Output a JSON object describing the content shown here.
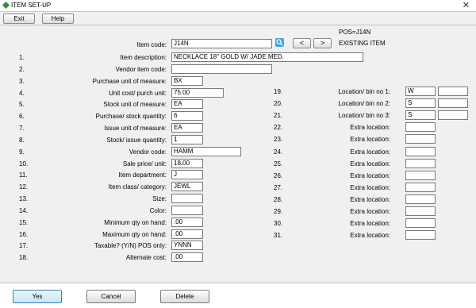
{
  "window": {
    "title": "ITEM SET-UP",
    "close_glyph": "✕"
  },
  "toolbar": {
    "exit_label": "Exit",
    "help_label": "Help"
  },
  "header": {
    "pos_label": "POS=J14N",
    "status": "EXISTING ITEM",
    "prev_label": "<",
    "next_label": ">"
  },
  "item_code": {
    "label": "Item code:",
    "value": "J14N"
  },
  "fields": [
    {
      "num": "1.",
      "label": "Item description:",
      "value": "NECKLACE 18\" GOLD W/ JADE MED."
    },
    {
      "num": "2.",
      "label": "Vendor item code:",
      "value": ""
    },
    {
      "num": "3.",
      "label": "Purchase unit of measure:",
      "value": "BX"
    },
    {
      "num": "4.",
      "label": "Unit cost/ purch unit:",
      "value": "75.00"
    },
    {
      "num": "5.",
      "label": "Stock unit of measure:",
      "value": "EA"
    },
    {
      "num": "6.",
      "label": "Purchase/ stock quantity:",
      "value": "6"
    },
    {
      "num": "7.",
      "label": "Issue unit of measure:",
      "value": "EA"
    },
    {
      "num": "8.",
      "label": "Stock/ issue quantity:",
      "value": "1"
    },
    {
      "num": "9.",
      "label": "Vendor code:",
      "value": "HAMM"
    },
    {
      "num": "10.",
      "label": "Sale price/ unit:",
      "value": "18.00"
    },
    {
      "num": "11.",
      "label": "Item department:",
      "value": "J"
    },
    {
      "num": "12.",
      "label": "Item class/ category:",
      "value": "JEWL"
    },
    {
      "num": "13.",
      "label": "Size:",
      "value": ""
    },
    {
      "num": "14.",
      "label": "Color:",
      "value": ""
    },
    {
      "num": "15.",
      "label": "Minimum qty on hand:",
      "value": ".00"
    },
    {
      "num": "16.",
      "label": "Maximum qty on hand:",
      "value": ".00"
    },
    {
      "num": "17.",
      "label": "Taxable? (Y/N) POS only:",
      "value": "YNNN"
    },
    {
      "num": "18.",
      "label": "Alternate cost:",
      "value": ".00"
    }
  ],
  "right_fields": [
    {
      "num": "19.",
      "label": "Location/ bin no 1:",
      "value": "W",
      "value2": ""
    },
    {
      "num": "20.",
      "label": "Location/ bin no 2:",
      "value": "S",
      "value2": ""
    },
    {
      "num": "21.",
      "label": "Location/ bin no 3:",
      "value": "S",
      "value2": ""
    },
    {
      "num": "22.",
      "label": "Extra location:",
      "value": ""
    },
    {
      "num": "23.",
      "label": "Extra location:",
      "value": ""
    },
    {
      "num": "24.",
      "label": "Extra location:",
      "value": ""
    },
    {
      "num": "25.",
      "label": "Extra location:",
      "value": ""
    },
    {
      "num": "26.",
      "label": "Extra location:",
      "value": ""
    },
    {
      "num": "27.",
      "label": "Extra location:",
      "value": ""
    },
    {
      "num": "28.",
      "label": "Extra location:",
      "value": ""
    },
    {
      "num": "29.",
      "label": "Extra location:",
      "value": ""
    },
    {
      "num": "30.",
      "label": "Extra location:",
      "value": ""
    },
    {
      "num": "31.",
      "label": "Extra location:",
      "value": ""
    }
  ],
  "footer": {
    "yes_label": "Yes",
    "cancel_label": "Cancel",
    "delete_label": "Delete"
  }
}
